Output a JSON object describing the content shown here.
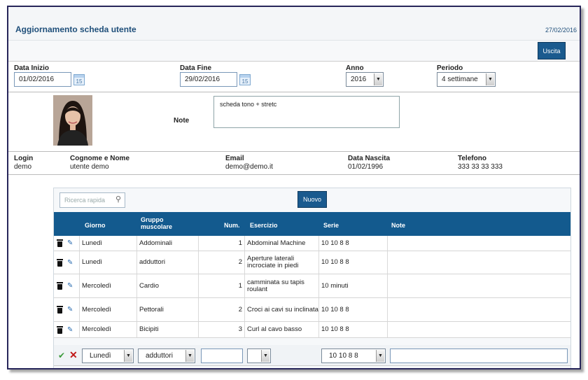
{
  "header": {
    "title": "Aggiornamento scheda utente",
    "date": "27/02/2016"
  },
  "toolbar": {
    "exit_label": "Uscita"
  },
  "filters": {
    "start_label": "Data Inizio",
    "start_value": "01/02/2016",
    "end_label": "Data Fine",
    "end_value": "29/02/2016",
    "year_label": "Anno",
    "year_value": "2016",
    "period_label": "Periodo",
    "period_value": "4 settimane",
    "calendar_glyph": "15"
  },
  "profile": {
    "note_label": "Note",
    "note_text": "scheda tono + stretc"
  },
  "user": {
    "login_label": "Login",
    "login_value": "demo",
    "name_label": "Cognome e Nome",
    "name_value": "utente demo",
    "email_label": "Email",
    "email_value": "demo@demo.it",
    "birth_label": "Data Nascita",
    "birth_value": "01/02/1996",
    "phone_label": "Telefono",
    "phone_value": "333 33 33 333"
  },
  "grid": {
    "search_placeholder": "Ricerca rapida",
    "new_label": "Nuovo",
    "columns": {
      "day": "Giorno",
      "group_line1": "Gruppo",
      "group_line2": "muscolare",
      "num": "Num.",
      "exercise": "Esercizio",
      "series": "Serie",
      "notes": "Note"
    },
    "rows": [
      {
        "day": "Lunedì",
        "group": "Addominali",
        "num": "1",
        "exercise": "Abdominal Machine",
        "series": "10 10 8 8",
        "notes": ""
      },
      {
        "day": "Lunedì",
        "group": "adduttori",
        "num": "2",
        "exercise": "Aperture laterali incrociate in piedi",
        "series": "10 10 8 8",
        "notes": ""
      },
      {
        "day": "Mercoledì",
        "group": "Cardio",
        "num": "1",
        "exercise": "camminata su tapis roulant",
        "series": "10 minuti",
        "notes": ""
      },
      {
        "day": "Mercoledì",
        "group": "Pettorali",
        "num": "2",
        "exercise": "Croci ai cavi su inclinata",
        "series": "10 10 8 8",
        "notes": ""
      },
      {
        "day": "Mercoledì",
        "group": "Bicipiti",
        "num": "3",
        "exercise": "Curl al cavo basso",
        "series": "10 10 8 8",
        "notes": ""
      }
    ],
    "edit": {
      "day": "Lunedì",
      "group": "adduttori",
      "series": "10 10 8 8"
    }
  },
  "icons": {
    "delete": "trash-icon",
    "edit": "pencil-icon",
    "confirm": "check-icon",
    "cancel": "close-icon",
    "search": "search-icon",
    "calendar": "calendar-icon",
    "dropdown": "chevron-down-icon"
  },
  "colors": {
    "accent": "#135a8e",
    "title": "#1f4f7a",
    "frame": "#27265a"
  }
}
